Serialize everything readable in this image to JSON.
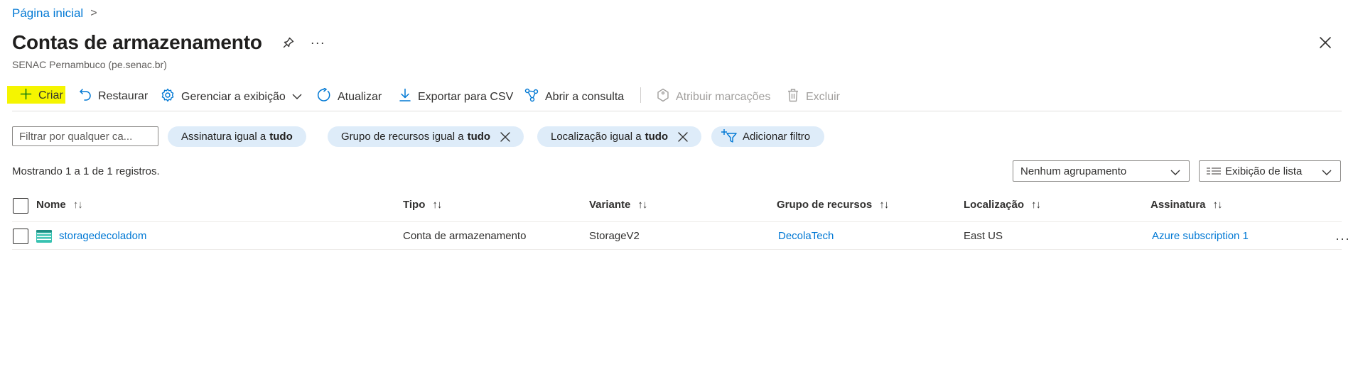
{
  "breadcrumb": {
    "home": "Página inicial",
    "chevron": ">"
  },
  "header": {
    "title": "Contas de armazenamento",
    "subtitle": "SENAC Pernambuco (pe.senac.br)",
    "more": "···"
  },
  "toolbar": {
    "create": "Criar",
    "restore": "Restaurar",
    "manage_view": "Gerenciar a exibição",
    "refresh": "Atualizar",
    "export_csv": "Exportar para CSV",
    "open_query": "Abrir a consulta",
    "assign_tags": "Atribuir marcações",
    "delete": "Excluir"
  },
  "filters": {
    "search_placeholder": "Filtrar por qualquer ca...",
    "subscription": {
      "label": "Assinatura igual a",
      "value": "tudo"
    },
    "resource_group": {
      "label": "Grupo de recursos igual a",
      "value": "tudo"
    },
    "location": {
      "label": "Localização igual a",
      "value": "tudo"
    },
    "add_filter": "Adicionar filtro"
  },
  "records_text": "Mostrando 1 a 1 de 1 registros.",
  "grouping": {
    "selected": "Nenhum agrupamento"
  },
  "view": {
    "selected": "Exibição de lista"
  },
  "table": {
    "columns": [
      "Nome",
      "Tipo",
      "Variante",
      "Grupo de recursos",
      "Localização",
      "Assinatura"
    ],
    "rows": [
      {
        "name": "storagedecoladom",
        "type": "Conta de armazenamento",
        "variant": "StorageV2",
        "resource_group": "DecolaTech",
        "location": "East US",
        "subscription": "Azure subscription 1"
      }
    ],
    "row_more": "···"
  },
  "colors": {
    "accent": "#0078d4",
    "pill_bg": "#deecf9",
    "highlight": "#f5f500",
    "disabled": "#a19f9d"
  }
}
